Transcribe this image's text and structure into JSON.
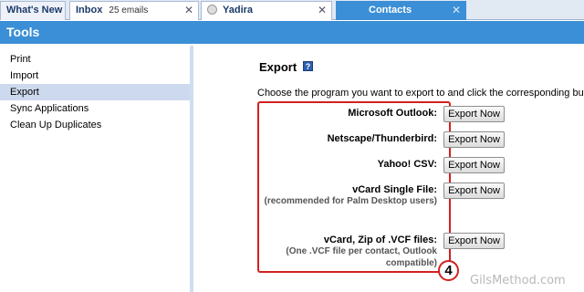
{
  "tabs": [
    {
      "label": "What's New",
      "sub": "",
      "active": false
    },
    {
      "label": "Inbox",
      "sub": "25 emails",
      "active": false
    },
    {
      "label": "Yadira",
      "sub": "",
      "active": false
    },
    {
      "label": "Contacts",
      "sub": "",
      "active": true
    }
  ],
  "tools_header": "Tools",
  "sidebar": {
    "items": [
      {
        "label": "Print",
        "selected": false
      },
      {
        "label": "Import",
        "selected": false
      },
      {
        "label": "Export",
        "selected": true
      },
      {
        "label": "Sync Applications",
        "selected": false
      },
      {
        "label": "Clean Up Duplicates",
        "selected": false
      }
    ]
  },
  "main": {
    "title": "Export",
    "help_icon": "?",
    "instructions": "Choose the program you want to export to and click the corresponding button:",
    "rows": [
      {
        "label": "Microsoft Outlook:",
        "note": "",
        "button": "Export Now"
      },
      {
        "label": "Netscape/Thunderbird:",
        "note": "",
        "button": "Export Now"
      },
      {
        "label": "Yahoo! CSV:",
        "note": "",
        "button": "Export Now"
      },
      {
        "label": "vCard Single File:",
        "note": "(recommended for Palm Desktop users)",
        "button": "Export Now"
      },
      {
        "label": "vCard, Zip of .VCF files:",
        "note": "(One .VCF file per contact, Outlook compatible)",
        "button": "Export Now"
      }
    ]
  },
  "callout_number": "4",
  "watermark": "GilsMethod.com",
  "colors": {
    "accent": "#3b8fd6",
    "highlight": "#d32020",
    "selected": "#cdd9ee"
  }
}
